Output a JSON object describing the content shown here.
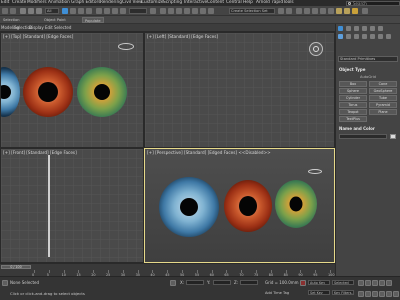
{
  "menubar": {
    "items": [
      "Edit",
      "Create",
      "Modifiers",
      "Animation",
      "Graph Editors",
      "Rendering",
      "Civil View",
      "Customize",
      "Scripting",
      "Interactive",
      "Content",
      "Central",
      "Help",
      "Arnold",
      "rapidTools"
    ],
    "search_placeholder": "Search"
  },
  "toolbar1": {
    "selection_filter": "All",
    "named_selection": "Create Selection Set"
  },
  "toolbar2": {
    "buttons": [
      "Selection",
      "Object Paint",
      "Populate"
    ]
  },
  "subtabs": {
    "items": [
      "Modeling",
      "Selection",
      "Display",
      "Edit Selected"
    ]
  },
  "viewports": {
    "top_left_label": "[+] [Top] [Standard] [Edge Faces]",
    "top_right_label": "[+] [Left] [Standard] [Edge Faces]",
    "bottom_left_label": "[+] [Front] [Standard] [Edge Faces]",
    "bottom_right_label": "[+] [Perspective] [Standard] [Edged Faces] <<Disabled>>"
  },
  "command_panel": {
    "category": "Standard Primitives",
    "object_type_heading": "Object Type",
    "autogrid_label": "AutoGrid",
    "buttons": [
      "Box",
      "Cone",
      "Sphere",
      "GeoSphere",
      "Cylinder",
      "Tube",
      "Torus",
      "Pyramid",
      "Teapot",
      "Plane",
      "TextPlus"
    ],
    "name_color_heading": "Name and Color"
  },
  "timeline": {
    "slider_label": "0 / 100",
    "ticks": [
      "0",
      "5",
      "10",
      "15",
      "20",
      "25",
      "30",
      "35",
      "40",
      "45",
      "50",
      "55",
      "60",
      "65",
      "70",
      "75",
      "80",
      "85",
      "90",
      "95",
      "100"
    ]
  },
  "status": {
    "selection_text": "None Selected",
    "prompt_text": "Click or click-and-drag to select objects",
    "grid_text": "Grid = 100.0mm",
    "x_label": "X:",
    "y_label": "Y:",
    "z_label": "Z:",
    "addtime_text": "Add Time Tag",
    "autokey_label": "Auto Key",
    "selected_label": "Selected",
    "setkey_label": "Set Key",
    "keyfilters_label": "Key Filters..."
  },
  "colors": {
    "background": "#3c3c3c",
    "active_viewport_border": "#e6d98a",
    "accent_blue": "#3f8fd6"
  }
}
